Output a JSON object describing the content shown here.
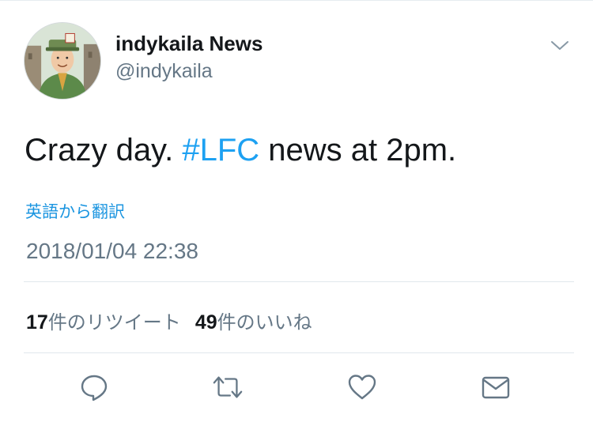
{
  "tweet": {
    "author_name": "indykaila  News",
    "author_handle": "@indykaila",
    "text_before": "Crazy day. ",
    "hashtag": "#LFC",
    "text_after": " news at 2pm.",
    "translate_label": "英語から翻訳",
    "timestamp": "2018/01/04 22:38"
  },
  "stats": {
    "retweet_count": "17",
    "retweet_label": "件のリツイート",
    "like_count": "49",
    "like_label": "件のいいね"
  },
  "actions": [
    {
      "name": "reply",
      "icon": "speech-bubble-icon"
    },
    {
      "name": "retweet",
      "icon": "retweet-arrows-icon"
    },
    {
      "name": "like",
      "icon": "heart-icon"
    },
    {
      "name": "message",
      "icon": "envelope-icon"
    }
  ],
  "colors": {
    "link_blue": "#1da1f2",
    "secondary_text": "#657786",
    "primary_text": "#14171a",
    "icon_gray": "#657786"
  }
}
